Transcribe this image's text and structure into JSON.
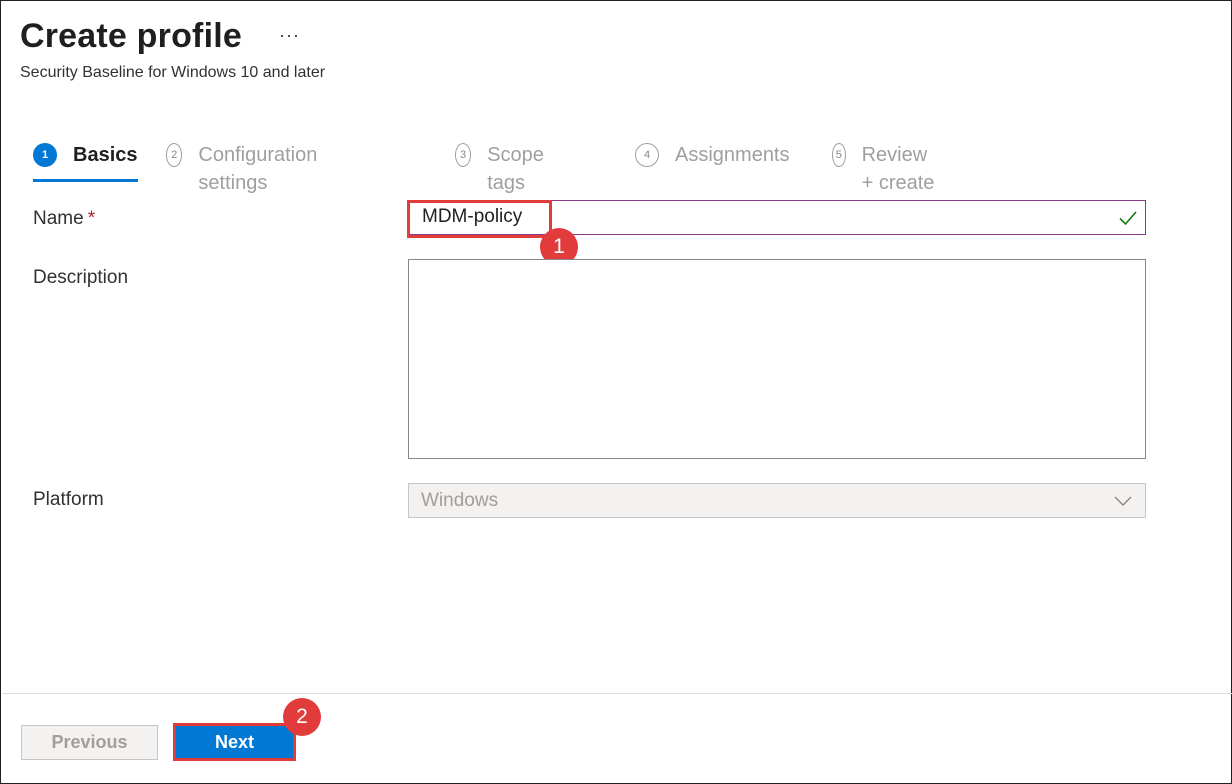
{
  "header": {
    "title": "Create profile",
    "more_label": "···",
    "subtitle": "Security Baseline for Windows 10 and later"
  },
  "steps": [
    {
      "number": "1",
      "label": "Basics",
      "active": true
    },
    {
      "number": "2",
      "label": "Configuration settings",
      "active": false
    },
    {
      "number": "3",
      "label": "Scope tags",
      "active": false
    },
    {
      "number": "4",
      "label": "Assignments",
      "active": false
    },
    {
      "number": "5",
      "label": "Review + create",
      "active": false
    }
  ],
  "form": {
    "name_label": "Name",
    "required_mark": "*",
    "name_value": "MDM-policy",
    "description_label": "Description",
    "description_value": "",
    "platform_label": "Platform",
    "platform_value": "Windows"
  },
  "annotations": {
    "badge1": "1",
    "badge2": "2"
  },
  "footer": {
    "previous_label": "Previous",
    "next_label": "Next"
  },
  "colors": {
    "accent": "#0078d4",
    "highlight": "#e13b3b",
    "valid_check": "#107c10"
  },
  "icons": {
    "name_valid": "checkmark-icon",
    "platform_dropdown": "chevron-down-icon"
  }
}
